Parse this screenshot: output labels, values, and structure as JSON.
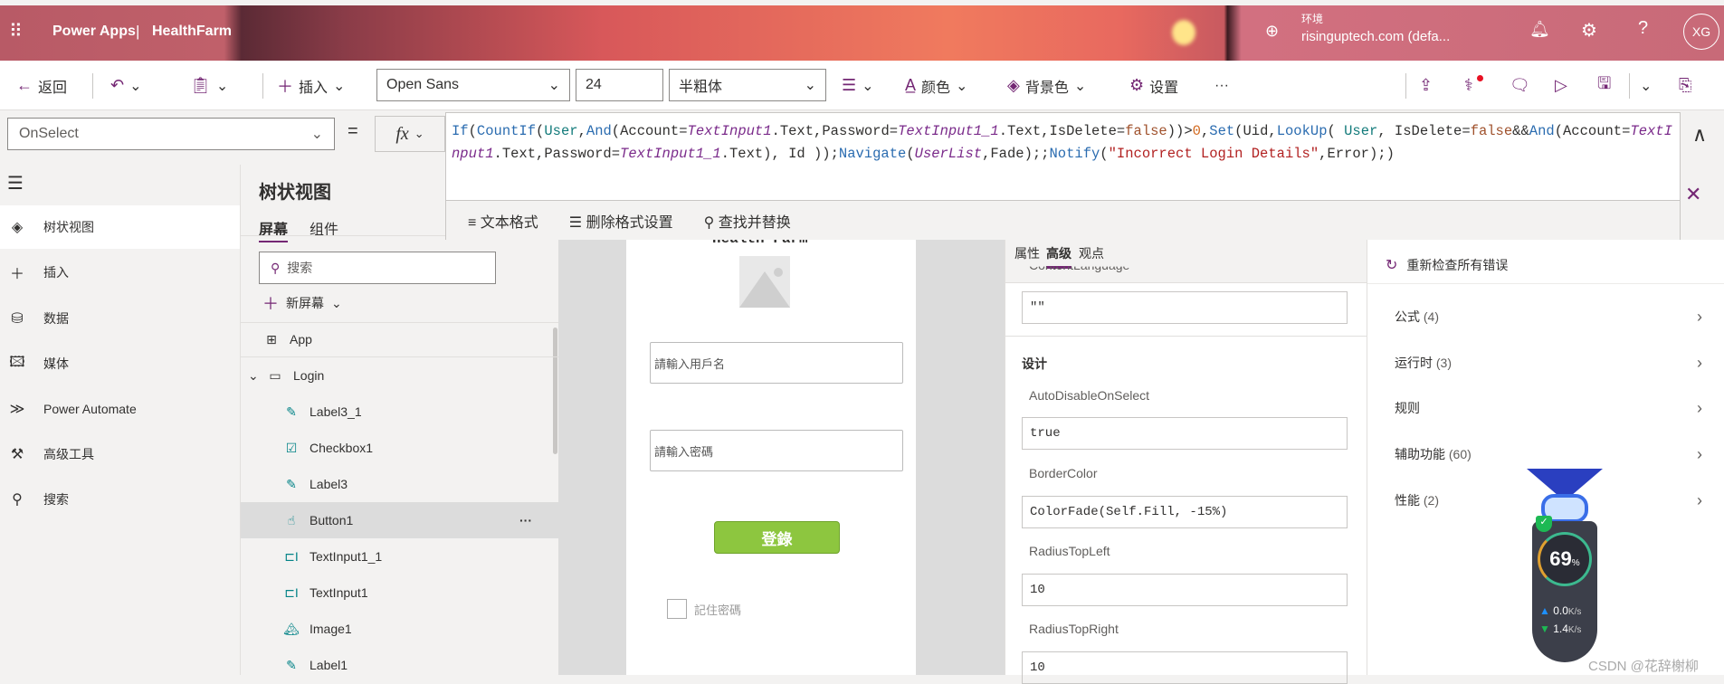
{
  "header": {
    "app_name": "Power Apps",
    "separator": "|",
    "project": "HealthFarm",
    "env_label": "环境",
    "env_value": "risinguptech.com (defa...",
    "avatar": "XG"
  },
  "toolbar": {
    "back": "返回",
    "insert": "插入",
    "font": "Open Sans",
    "font_size": "24",
    "font_weight": "半粗体",
    "color": "颜色",
    "fill": "背景色",
    "settings": "设置",
    "more": "···"
  },
  "formula_bar": {
    "property": "OnSelect",
    "equals": "=",
    "fx": "fx",
    "code": [
      [
        "If",
        "fn"
      ],
      [
        "(",
        ""
      ],
      [
        "CountIf",
        "fn"
      ],
      [
        "(",
        ""
      ],
      [
        "User",
        "tbl"
      ],
      [
        ",",
        ""
      ],
      [
        "And",
        "fn"
      ],
      [
        "(Account=",
        ""
      ],
      [
        "TextInput1",
        "ctl"
      ],
      [
        ".Text,Password=",
        ""
      ],
      [
        "TextInput1_1",
        "ctl"
      ],
      [
        ".Text,IsDelete=",
        ""
      ],
      [
        "false",
        "lit"
      ],
      [
        "))>",
        ""
      ],
      [
        "0",
        "num"
      ],
      [
        ",",
        ""
      ],
      [
        "Set",
        "fn"
      ],
      [
        "(Uid,",
        ""
      ],
      [
        "LookUp",
        "fn"
      ],
      [
        "( ",
        ""
      ],
      [
        "User",
        "tbl"
      ],
      [
        ", IsDelete=",
        ""
      ],
      [
        "false",
        "lit"
      ],
      [
        "&&",
        ""
      ],
      [
        "And",
        "fn"
      ],
      [
        "(Account=",
        ""
      ],
      [
        "TextInput1",
        "ctl"
      ],
      [
        ".Text,Password=",
        ""
      ],
      [
        "TextInput1_1",
        "ctl"
      ],
      [
        ".Text), Id ));",
        ""
      ],
      [
        "Navigate",
        "fn"
      ],
      [
        "(",
        ""
      ],
      [
        "UserList",
        "ctl"
      ],
      [
        ",Fade);;",
        ""
      ],
      [
        "Notify",
        "fn"
      ],
      [
        "(",
        ""
      ],
      [
        "\"Incorrect Login Details\"",
        "str"
      ],
      [
        ",Error);)",
        ""
      ]
    ],
    "format_text": "文本格式",
    "remove_format": "删除格式设置",
    "find_replace": "查找并替换"
  },
  "leftnav": {
    "items": [
      {
        "label": "树状视图",
        "icon": "layers-icon"
      },
      {
        "label": "插入",
        "icon": "plus-icon"
      },
      {
        "label": "数据",
        "icon": "database-icon"
      },
      {
        "label": "媒体",
        "icon": "media-icon"
      },
      {
        "label": "Power Automate",
        "icon": "power-automate-icon"
      },
      {
        "label": "高级工具",
        "icon": "tools-icon"
      },
      {
        "label": "搜索",
        "icon": "search-icon"
      }
    ]
  },
  "tree": {
    "title": "树状视图",
    "tabs": [
      "屏幕",
      "组件"
    ],
    "search_placeholder": "搜索",
    "new_screen": "新屏幕",
    "items": [
      {
        "label": "App",
        "icon": "app-icon"
      },
      {
        "label": "Login",
        "icon": "screen-icon"
      },
      {
        "label": "Label3_1",
        "icon": "label-icon"
      },
      {
        "label": "Checkbox1",
        "icon": "checkbox-icon"
      },
      {
        "label": "Label3",
        "icon": "label-icon"
      },
      {
        "label": "Button1",
        "icon": "button-icon",
        "selected": true
      },
      {
        "label": "TextInput1_1",
        "icon": "textinput-icon"
      },
      {
        "label": "TextInput1",
        "icon": "textinput-icon"
      },
      {
        "label": "Image1",
        "icon": "image-icon"
      },
      {
        "label": "Label1",
        "icon": "label-icon"
      }
    ]
  },
  "canvas": {
    "title": "Health Farm",
    "username_placeholder": "請輸入用戶名",
    "password_placeholder": "請輸入密碼",
    "login_button": "登錄",
    "remember": "記住密碼",
    "button_color": "#8dc63f"
  },
  "properties": {
    "tabs": [
      "属性",
      "高级",
      "观点"
    ],
    "active_tab": "高级",
    "content_language_label": "ContentLanguage",
    "content_language": "\"\"",
    "section": "设计",
    "fields": [
      {
        "label": "AutoDisableOnSelect",
        "value": "true"
      },
      {
        "label": "BorderColor",
        "value": "ColorFade(Self.Fill, -15%)"
      },
      {
        "label": "RadiusTopLeft",
        "value": "10"
      },
      {
        "label": "RadiusTopRight",
        "value": "10"
      }
    ]
  },
  "checker": {
    "recheck": "重新检查所有错误",
    "items": [
      {
        "label": "公式",
        "count": "(4)"
      },
      {
        "label": "运行时",
        "count": "(3)"
      },
      {
        "label": "规则",
        "count": ""
      },
      {
        "label": "辅助功能",
        "count": "(60)"
      },
      {
        "label": "性能",
        "count": "(2)"
      }
    ]
  },
  "widget": {
    "percent": "69",
    "percent_sign": "%",
    "up": "0.0",
    "down": "1.4",
    "unit": "K/s"
  },
  "watermark": "CSDN @花辞榭柳",
  "accent": "#742774"
}
